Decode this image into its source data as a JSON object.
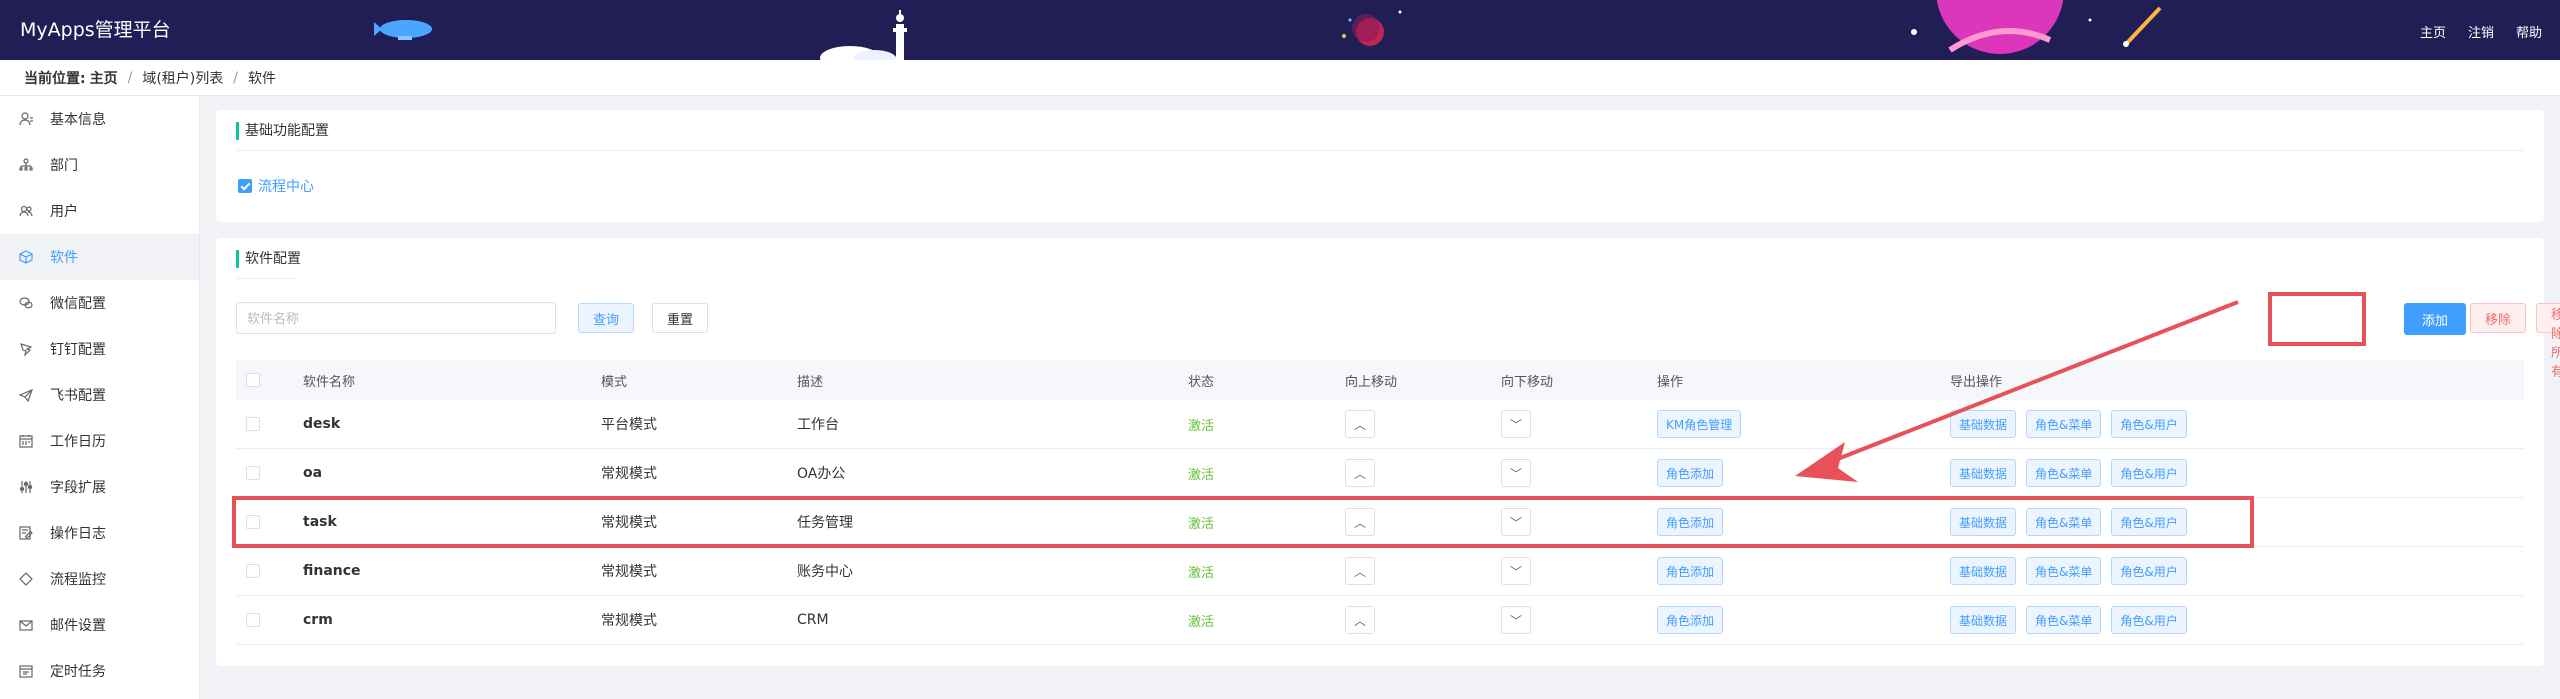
{
  "header": {
    "title": "MyApps管理平台",
    "nav": [
      "主页",
      "注销",
      "帮助"
    ]
  },
  "breadcrumb": {
    "label": "当前位置:",
    "items": [
      "主页",
      "域(租户)列表",
      "软件"
    ]
  },
  "sidebar": {
    "items": [
      {
        "label": "基本信息",
        "icon": "user-info-icon"
      },
      {
        "label": "部门",
        "icon": "department-icon"
      },
      {
        "label": "用户",
        "icon": "users-icon"
      },
      {
        "label": "软件",
        "icon": "cube-icon",
        "active": true
      },
      {
        "label": "微信配置",
        "icon": "wechat-icon"
      },
      {
        "label": "钉钉配置",
        "icon": "dingtalk-icon"
      },
      {
        "label": "飞书配置",
        "icon": "feishu-icon"
      },
      {
        "label": "工作日历",
        "icon": "calendar-icon"
      },
      {
        "label": "字段扩展",
        "icon": "sliders-icon"
      },
      {
        "label": "操作日志",
        "icon": "log-icon"
      },
      {
        "label": "流程监控",
        "icon": "diamond-icon"
      },
      {
        "label": "邮件设置",
        "icon": "mail-icon"
      },
      {
        "label": "定时任务",
        "icon": "schedule-icon"
      }
    ]
  },
  "basic_config": {
    "title": "基础功能配置",
    "checkbox_label": "流程中心",
    "checked": true
  },
  "software_config": {
    "title": "软件配置",
    "search_placeholder": "软件名称",
    "query_label": "查询",
    "reset_label": "重置",
    "add_label": "添加",
    "remove_label": "移除",
    "remove_all_label": "移除所有",
    "columns": [
      "软件名称",
      "模式",
      "描述",
      "状态",
      "向上移动",
      "向下移动",
      "操作",
      "导出操作"
    ],
    "rows": [
      {
        "name": "desk",
        "mode": "平台模式",
        "desc": "工作台",
        "status": "激活",
        "op": "KM角色管理"
      },
      {
        "name": "oa",
        "mode": "常规模式",
        "desc": "OA办公",
        "status": "激活",
        "op": "角色添加"
      },
      {
        "name": "task",
        "mode": "常规模式",
        "desc": "任务管理",
        "status": "激活",
        "op": "角色添加"
      },
      {
        "name": "finance",
        "mode": "常规模式",
        "desc": "账务中心",
        "status": "激活",
        "op": "角色添加"
      },
      {
        "name": "crm",
        "mode": "常规模式",
        "desc": "CRM",
        "status": "激活",
        "op": "角色添加"
      }
    ],
    "export_buttons": [
      "基础数据",
      "角色&菜单",
      "角色&用户"
    ]
  },
  "colors": {
    "header_bg": "#201e55",
    "accent": "#409eff",
    "active_status": "#67c23a",
    "section_bar": "#13c2a3",
    "annotation": "#e8515a",
    "danger": "#f56c6c"
  }
}
